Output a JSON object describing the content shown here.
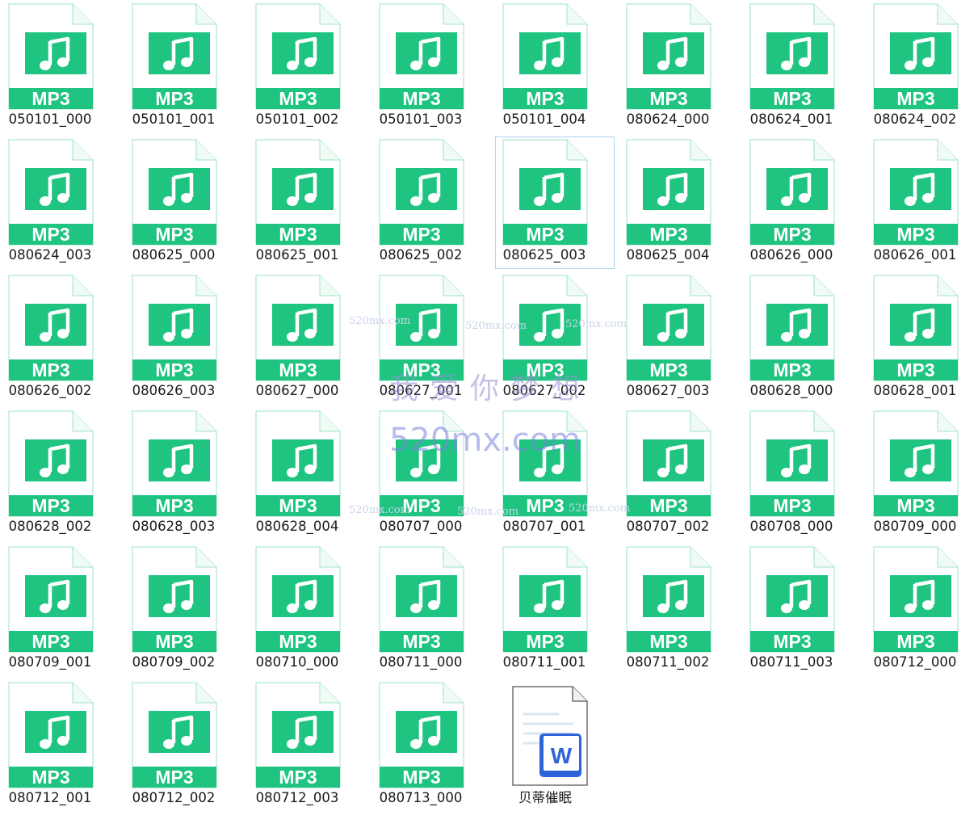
{
  "colors": {
    "accent": "#1fc481",
    "doc_blue": "#2f63d8",
    "selection": "#a9d6ee"
  },
  "mp3_badge": "MP3",
  "files": [
    {
      "name": "050101_000",
      "type": "mp3",
      "icon": "mp3-file-icon"
    },
    {
      "name": "050101_001",
      "type": "mp3",
      "icon": "mp3-file-icon"
    },
    {
      "name": "050101_002",
      "type": "mp3",
      "icon": "mp3-file-icon"
    },
    {
      "name": "050101_003",
      "type": "mp3",
      "icon": "mp3-file-icon"
    },
    {
      "name": "050101_004",
      "type": "mp3",
      "icon": "mp3-file-icon"
    },
    {
      "name": "080624_000",
      "type": "mp3",
      "icon": "mp3-file-icon"
    },
    {
      "name": "080624_001",
      "type": "mp3",
      "icon": "mp3-file-icon"
    },
    {
      "name": "080624_002",
      "type": "mp3",
      "icon": "mp3-file-icon"
    },
    {
      "name": "080624_003",
      "type": "mp3",
      "icon": "mp3-file-icon"
    },
    {
      "name": "080625_000",
      "type": "mp3",
      "icon": "mp3-file-icon"
    },
    {
      "name": "080625_001",
      "type": "mp3",
      "icon": "mp3-file-icon"
    },
    {
      "name": "080625_002",
      "type": "mp3",
      "icon": "mp3-file-icon"
    },
    {
      "name": "080625_003",
      "type": "mp3",
      "icon": "mp3-file-icon",
      "selected": true
    },
    {
      "name": "080625_004",
      "type": "mp3",
      "icon": "mp3-file-icon"
    },
    {
      "name": "080626_000",
      "type": "mp3",
      "icon": "mp3-file-icon"
    },
    {
      "name": "080626_001",
      "type": "mp3",
      "icon": "mp3-file-icon"
    },
    {
      "name": "080626_002",
      "type": "mp3",
      "icon": "mp3-file-icon"
    },
    {
      "name": "080626_003",
      "type": "mp3",
      "icon": "mp3-file-icon"
    },
    {
      "name": "080627_000",
      "type": "mp3",
      "icon": "mp3-file-icon"
    },
    {
      "name": "080627_001",
      "type": "mp3",
      "icon": "mp3-file-icon"
    },
    {
      "name": "080627_002",
      "type": "mp3",
      "icon": "mp3-file-icon"
    },
    {
      "name": "080627_003",
      "type": "mp3",
      "icon": "mp3-file-icon"
    },
    {
      "name": "080628_000",
      "type": "mp3",
      "icon": "mp3-file-icon"
    },
    {
      "name": "080628_001",
      "type": "mp3",
      "icon": "mp3-file-icon"
    },
    {
      "name": "080628_002",
      "type": "mp3",
      "icon": "mp3-file-icon"
    },
    {
      "name": "080628_003",
      "type": "mp3",
      "icon": "mp3-file-icon"
    },
    {
      "name": "080628_004",
      "type": "mp3",
      "icon": "mp3-file-icon"
    },
    {
      "name": "080707_000",
      "type": "mp3",
      "icon": "mp3-file-icon"
    },
    {
      "name": "080707_001",
      "type": "mp3",
      "icon": "mp3-file-icon"
    },
    {
      "name": "080707_002",
      "type": "mp3",
      "icon": "mp3-file-icon"
    },
    {
      "name": "080708_000",
      "type": "mp3",
      "icon": "mp3-file-icon"
    },
    {
      "name": "080709_000",
      "type": "mp3",
      "icon": "mp3-file-icon"
    },
    {
      "name": "080709_001",
      "type": "mp3",
      "icon": "mp3-file-icon"
    },
    {
      "name": "080709_002",
      "type": "mp3",
      "icon": "mp3-file-icon"
    },
    {
      "name": "080710_000",
      "type": "mp3",
      "icon": "mp3-file-icon"
    },
    {
      "name": "080711_000",
      "type": "mp3",
      "icon": "mp3-file-icon"
    },
    {
      "name": "080711_001",
      "type": "mp3",
      "icon": "mp3-file-icon"
    },
    {
      "name": "080711_002",
      "type": "mp3",
      "icon": "mp3-file-icon"
    },
    {
      "name": "080711_003",
      "type": "mp3",
      "icon": "mp3-file-icon"
    },
    {
      "name": "080712_000",
      "type": "mp3",
      "icon": "mp3-file-icon"
    },
    {
      "name": "080712_001",
      "type": "mp3",
      "icon": "mp3-file-icon"
    },
    {
      "name": "080712_002",
      "type": "mp3",
      "icon": "mp3-file-icon"
    },
    {
      "name": "080712_003",
      "type": "mp3",
      "icon": "mp3-file-icon"
    },
    {
      "name": "080713_000",
      "type": "mp3",
      "icon": "mp3-file-icon"
    },
    {
      "name": "贝蒂催眠",
      "type": "docx",
      "icon": "word-document-icon",
      "badge": "W"
    }
  ],
  "watermark": {
    "main_cn": "我爱你梦想",
    "main_url": "520mx.com",
    "small_url": "520mx.com"
  }
}
